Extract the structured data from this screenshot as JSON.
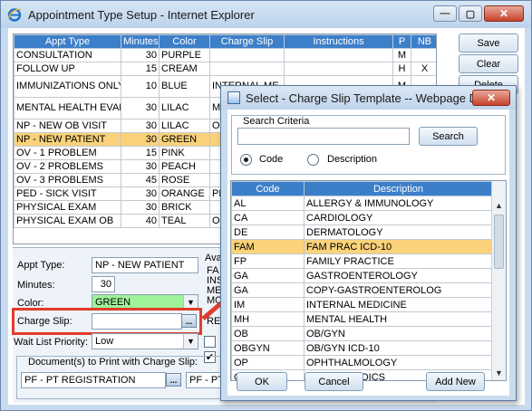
{
  "window": {
    "title": "Appointment Type Setup - Internet Explorer",
    "buttons": {
      "minimize": "—",
      "maximize": "▢",
      "close": "✕"
    }
  },
  "grid": {
    "columns": [
      "Appt Type",
      "Minutes",
      "Color",
      "Charge Slip",
      "Instructions",
      "P",
      "NB"
    ],
    "rows": [
      [
        "CONSULTATION",
        "30",
        "PURPLE",
        "",
        "",
        "M",
        ""
      ],
      [
        "FOLLOW UP",
        "15",
        "CREAM",
        "",
        "",
        "H",
        "X"
      ],
      [
        "IMMUNIZATIONS ONLY",
        "10",
        "BLUE",
        "INTERNAL ME",
        "",
        "M",
        ""
      ],
      [
        "MENTAL HEALTH EVAL",
        "30",
        "LILAC",
        "ME HE",
        "",
        "",
        ""
      ],
      [
        "NP - NEW OB VISIT",
        "30",
        "LILAC",
        "OB",
        "",
        "",
        ""
      ],
      [
        "NP - NEW PATIENT",
        "30",
        "GREEN",
        "",
        "",
        "",
        ""
      ],
      [
        "OV - 1 PROBLEM",
        "15",
        "PINK",
        "",
        "",
        "",
        ""
      ],
      [
        "OV - 2 PROBLEMS",
        "30",
        "PEACH",
        "",
        "",
        "",
        ""
      ],
      [
        "OV - 3 PROBLEMS",
        "45",
        "ROSE",
        "",
        "",
        "",
        ""
      ],
      [
        "PED - SICK VISIT",
        "30",
        "ORANGE",
        "PE",
        "",
        "",
        ""
      ],
      [
        "PHYSICAL EXAM",
        "30",
        "BRICK",
        "",
        "",
        "",
        ""
      ],
      [
        "PHYSICAL EXAM OB",
        "40",
        "TEAL",
        "OB",
        "",
        "",
        ""
      ]
    ],
    "selected_index": 5
  },
  "side_buttons": {
    "save": "Save",
    "clear": "Clear",
    "delete": "Delete"
  },
  "form": {
    "appt_type_label": "Appt Type:",
    "appt_type_value": "NP - NEW PATIENT",
    "minutes_label": "Minutes:",
    "minutes_value": "30",
    "color_label": "Color:",
    "color_value": "GREEN",
    "charge_slip_label": "Charge Slip:",
    "charge_slip_value": "",
    "ellipsis": "...",
    "wait_list_label": "Wait List Priority:",
    "wait_list_value": "Low",
    "avail_partial": "Ava",
    "avail_items": [
      "FA",
      "INS",
      "ME",
      "MO",
      "RE"
    ],
    "docs_label": "Document(s) to Print with Charge Slip:",
    "doc1": "PF - PT REGISTRATION",
    "doc2": "PF - PT"
  },
  "dialog": {
    "title": "Select - Charge Slip Template -- Webpage Dia...",
    "close": "✕",
    "criteria_label": "Search Criteria",
    "search_input": "",
    "search_button": "Search",
    "radio_code": "Code",
    "radio_description": "Description",
    "columns": [
      "Code",
      "Description"
    ],
    "rows": [
      [
        "AL",
        "ALLERGY & IMMUNOLOGY"
      ],
      [
        "CA",
        "CARDIOLOGY"
      ],
      [
        "DE",
        "DERMATOLOGY"
      ],
      [
        "FAM",
        "FAM PRAC ICD-10"
      ],
      [
        "FP",
        "FAMILY PRACTICE"
      ],
      [
        "GA",
        "GASTROENTEROLOGY"
      ],
      [
        "GA",
        "COPY-GASTROENTEROLOG"
      ],
      [
        "IM",
        "INTERNAL MEDICINE"
      ],
      [
        "MH",
        "MENTAL HEALTH"
      ],
      [
        "OB",
        "OB/GYN"
      ],
      [
        "OBGYN",
        "OB/GYN ICD-10"
      ],
      [
        "OP",
        "OPHTHALMOLOGY"
      ],
      [
        "ORT",
        "ORTHOPAEDICS"
      ]
    ],
    "selected_index": 3,
    "ok": "OK",
    "cancel": "Cancel",
    "add_new": "Add New"
  },
  "colors": {
    "accent": "#3c7fc9",
    "selected": "#f9d27a",
    "highlight": "#e23c2a",
    "green_field": "#9ff29a"
  }
}
